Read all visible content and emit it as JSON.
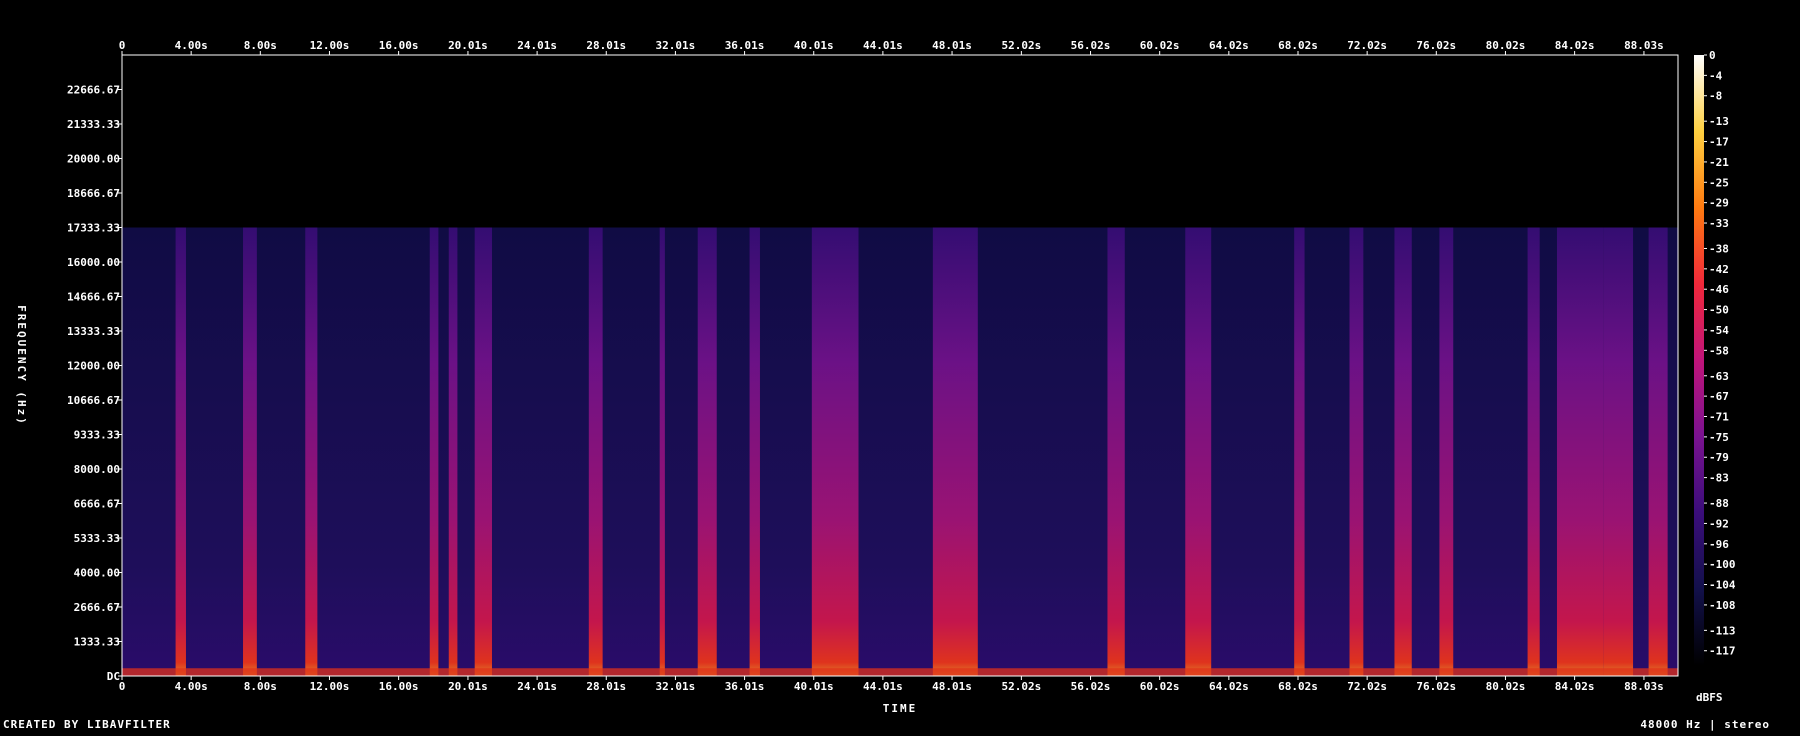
{
  "chart_data": {
    "type": "heatmap",
    "title": "",
    "xlabel": "TIME",
    "ylabel": "FREQUENCY (Hz)",
    "x_tick_labels": [
      "0",
      "4.00s",
      "8.00s",
      "12.00s",
      "16.00s",
      "20.01s",
      "24.01s",
      "28.01s",
      "32.01s",
      "36.01s",
      "40.01s",
      "44.01s",
      "48.01s",
      "52.02s",
      "56.02s",
      "60.02s",
      "64.02s",
      "68.02s",
      "72.02s",
      "76.02s",
      "80.02s",
      "84.02s",
      "88.03s"
    ],
    "x_tick_values": [
      0,
      4.0,
      8.0,
      12.0,
      16.0,
      20.01,
      24.01,
      28.01,
      32.01,
      36.01,
      40.01,
      44.01,
      48.01,
      52.02,
      56.02,
      60.02,
      64.02,
      68.02,
      72.02,
      76.02,
      80.02,
      84.02,
      88.03
    ],
    "xlim": [
      0,
      90.0
    ],
    "y_tick_labels": [
      "DC",
      "1333.33",
      "2666.67",
      "4000.00",
      "5333.33",
      "6666.67",
      "8000.00",
      "9333.33",
      "10666.67",
      "12000.00",
      "13333.33",
      "14666.67",
      "16000.00",
      "17333.33",
      "18666.67",
      "20000.00",
      "21333.33",
      "22666.67"
    ],
    "y_tick_values": [
      0,
      1333.33,
      2666.67,
      4000,
      5333.33,
      6666.67,
      8000,
      9333.33,
      10666.67,
      12000,
      13333.33,
      14666.67,
      16000,
      17333.33,
      18666.67,
      20000,
      21333.33,
      22666.67
    ],
    "ylim": [
      0,
      24000
    ],
    "colorbar": {
      "unit": "dBFS",
      "tick_labels": [
        "0",
        "-4",
        "-8",
        "-13",
        "-17",
        "-21",
        "-25",
        "-29",
        "-33",
        "-38",
        "-42",
        "-46",
        "-50",
        "-54",
        "-58",
        "-63",
        "-67",
        "-71",
        "-75",
        "-79",
        "-83",
        "-88",
        "-92",
        "-96",
        "-100",
        "-104",
        "-108",
        "-113",
        "-117"
      ],
      "tick_values": [
        0,
        -4,
        -8,
        -13,
        -17,
        -21,
        -25,
        -29,
        -33,
        -38,
        -42,
        -46,
        -50,
        -54,
        -58,
        -63,
        -67,
        -71,
        -75,
        -79,
        -83,
        -88,
        -92,
        -96,
        -100,
        -104,
        -108,
        -113,
        -117
      ],
      "range": [
        -120,
        0
      ],
      "colors": [
        "#000000",
        "#12104a",
        "#3a0d7a",
        "#7a1290",
        "#c0147a",
        "#f0283a",
        "#ff7a10",
        "#ffd040",
        "#ffffff"
      ]
    },
    "bandwidth_cutoff_hz": 17333.33,
    "loud_segments_s": [
      [
        3.1,
        3.7
      ],
      [
        7.0,
        7.8
      ],
      [
        10.6,
        11.3
      ],
      [
        17.8,
        18.3
      ],
      [
        18.9,
        19.4
      ],
      [
        20.4,
        21.4
      ],
      [
        27.0,
        27.8
      ],
      [
        31.1,
        31.4
      ],
      [
        33.3,
        34.4
      ],
      [
        36.3,
        36.9
      ],
      [
        39.9,
        42.6
      ],
      [
        46.9,
        49.5
      ],
      [
        57.0,
        58.0
      ],
      [
        61.5,
        63.0
      ],
      [
        67.8,
        68.4
      ],
      [
        71.0,
        71.8
      ],
      [
        73.6,
        74.6
      ],
      [
        76.2,
        77.0
      ],
      [
        81.3,
        82.0
      ],
      [
        83.0,
        85.7
      ],
      [
        85.7,
        87.4
      ],
      [
        88.3,
        89.4
      ]
    ]
  },
  "footer": {
    "credit": "CREATED BY LIBAVFILTER",
    "info": "48000 Hz | stereo"
  },
  "colors": {
    "background": "#000000",
    "text": "#ffffff"
  }
}
